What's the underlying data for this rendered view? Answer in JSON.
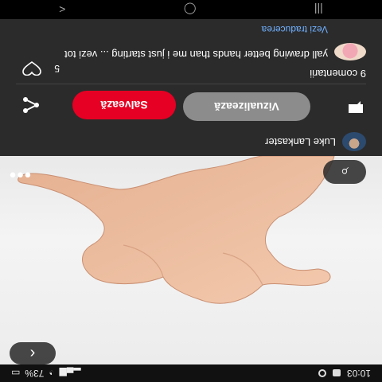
{
  "status_bar": {
    "time": "10:03",
    "battery": "73%"
  },
  "pin": {
    "author_name": "Luke Lankaster",
    "view_label": "Vizualizează",
    "save_label": "Salvează"
  },
  "comments": {
    "count_label": "9 comentarii",
    "like_count": "5",
    "items": [
      {
        "text": "yall drawing better hands than me i just starting ... vezi tot",
        "meta": "Vezi traducerea"
      }
    ]
  },
  "colors": {
    "save": "#e60023",
    "view": "#8c8c8c",
    "link": "#6fb0ff"
  },
  "icons": [
    "back-icon",
    "more-icon",
    "lens-icon",
    "comment-icon",
    "share-icon",
    "heart-icon",
    "avatar"
  ]
}
